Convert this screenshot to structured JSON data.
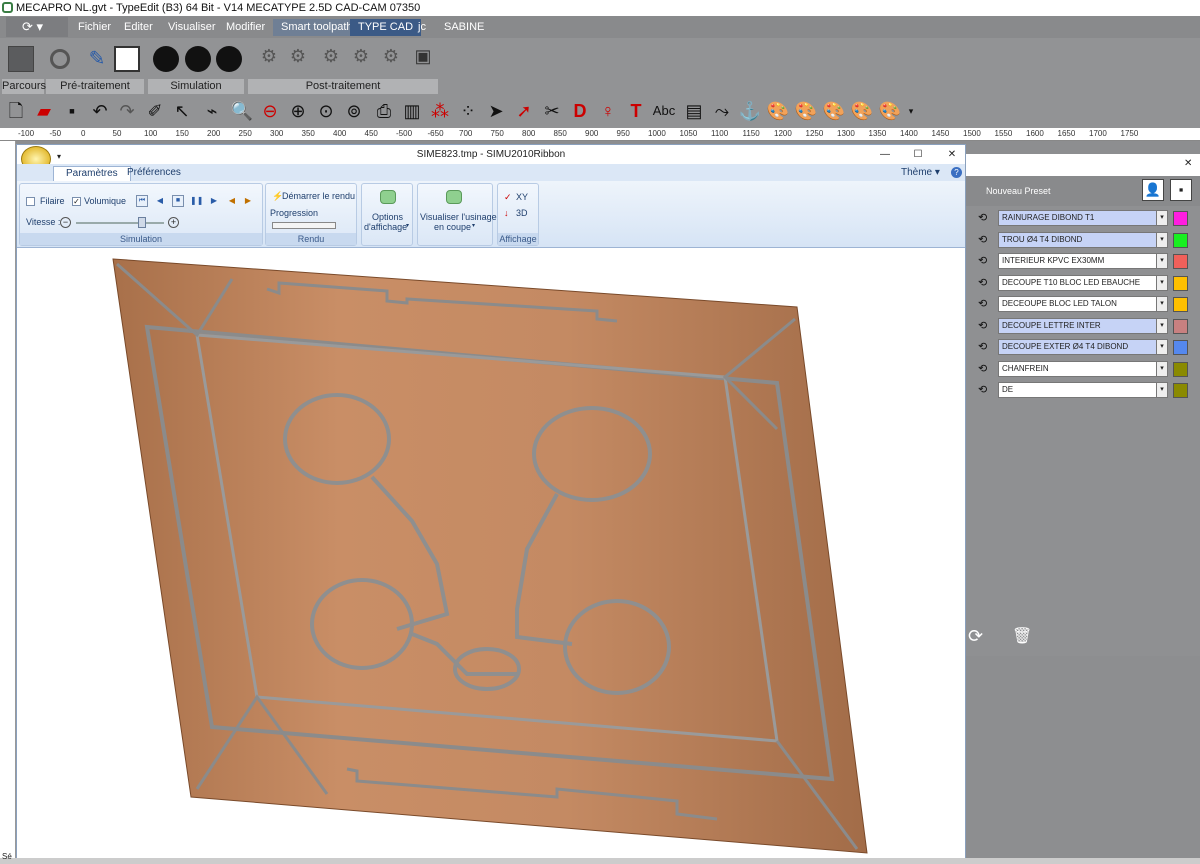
{
  "window": {
    "title": "MECAPRO NL.gvt - TypeEdit (B3) 64 Bit - V14 MECATYPE 2.5D CAD-CAM 07350"
  },
  "menu": {
    "items": [
      "Fichier",
      "Editer",
      "Visualiser",
      "Modifier",
      "Smart toolpath",
      "TYPE CAD",
      "jc",
      "SABINE"
    ]
  },
  "groups": {
    "parcours": "Parcours",
    "pretraitement": "Pré-traitement",
    "simulation": "Simulation",
    "posttraitement": "Post-traitement"
  },
  "toolbar2": {
    "abc_label": "Abc"
  },
  "ruler": {
    "labels": [
      "-100",
      "-50",
      "0",
      "50",
      "100",
      "150",
      "200",
      "250",
      "300",
      "350",
      "400",
      "450",
      "-500",
      "-650",
      "700",
      "750",
      "800",
      "850",
      "900",
      "950",
      "1000",
      "1050",
      "1100",
      "1150",
      "1200",
      "1250",
      "1300",
      "1350",
      "1400",
      "1450",
      "1500",
      "1550",
      "1600",
      "1650",
      "1700",
      "1750"
    ]
  },
  "sim": {
    "title": "SIME823.tmp - SIMU2010Ribbon",
    "tabs": {
      "params": "Paramètres",
      "prefs": "Préférences"
    },
    "theme": "Thème",
    "ribbon": {
      "filaire": "Filaire",
      "volumique": "Volumique",
      "vitesse": "Vitesse :",
      "simulation_label": "Simulation",
      "start_render": "Démarrer le rendu",
      "progression": "Progression",
      "rendu_label": "Rendu",
      "options_l1": "Options",
      "options_l2": "d'affichage",
      "visualiser_l1": "Visualiser l'usinage",
      "visualiser_l2": "en coupe",
      "xy": "XY",
      "d3": "3D",
      "affichage_label": "Affichage"
    }
  },
  "panel": {
    "preset_label": "Nouveau Preset",
    "rows": [
      {
        "label": "RAINURAGE DIBOND T1",
        "color": "#ff1ee0",
        "selected": true
      },
      {
        "label": "TROU Ø4 T4 DIBOND",
        "color": "#18f020",
        "selected": true
      },
      {
        "label": " INTERIEUR KPVC EX30MM",
        "color": "#f0605a",
        "selected": false
      },
      {
        "label": "DECOUPE T10 BLOC LED EBAUCHE",
        "color": "#ffc000",
        "selected": false
      },
      {
        "label": "DECEOUPE BLOC LED TALON",
        "color": "#ffc000",
        "selected": false
      },
      {
        "label": "DECOUPE LETTRE INTER",
        "color": "#c88080",
        "selected": true
      },
      {
        "label": "DECOUPE EXTER Ø4 T4 DIBOND",
        "color": "#5588ee",
        "selected": true
      },
      {
        "label": "CHANFREIN",
        "color": "#8a8a00",
        "selected": false
      },
      {
        "label": "DE",
        "color": "#8a8a00",
        "selected": false
      }
    ]
  },
  "status": {
    "left": "Sé"
  }
}
